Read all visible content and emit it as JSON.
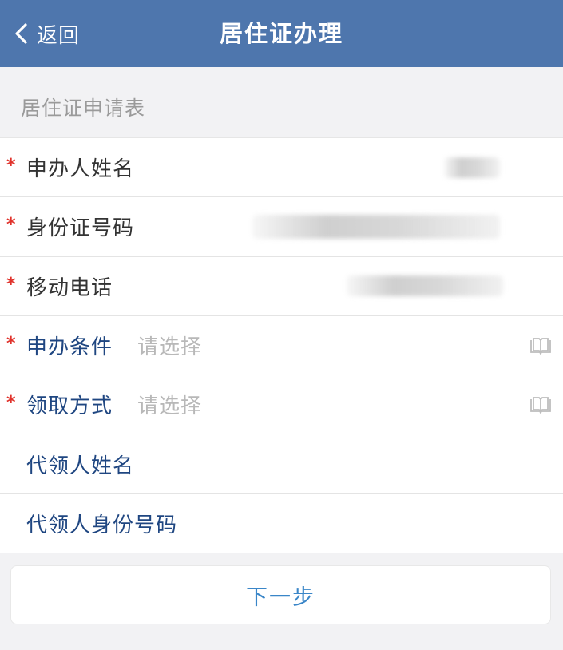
{
  "header": {
    "back_label": "返回",
    "title": "居住证办理",
    "back_icon": "chevron-left-icon"
  },
  "section_title": "居住证申请表",
  "form": {
    "rows": [
      {
        "label": "申办人姓名",
        "required": true,
        "value": ""
      },
      {
        "label": "身份证号码",
        "required": true,
        "value": ""
      },
      {
        "label": "移动电话",
        "required": true,
        "value": ""
      },
      {
        "label": "申办条件",
        "required": true,
        "placeholder": "请选择",
        "icon": "book-icon"
      },
      {
        "label": "领取方式",
        "required": true,
        "placeholder": "请选择",
        "icon": "book-icon"
      },
      {
        "label": "代领人姓名",
        "required": false
      },
      {
        "label": "代领人身份号码",
        "required": false
      }
    ],
    "required_mark": "*"
  },
  "next_button": {
    "label": "下一步"
  },
  "colors": {
    "navbar": "#4e76ad",
    "required": "#e0322b",
    "label_blue": "#1f4681",
    "button_text": "#3a86c8"
  }
}
